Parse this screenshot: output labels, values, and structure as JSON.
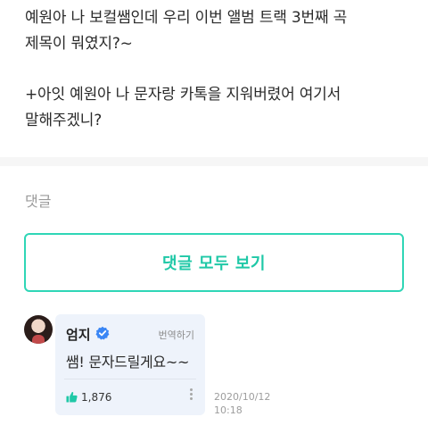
{
  "post": {
    "lines": [
      "예원아 나 보컬쌤인데 우리 이번 앨범 트랙 3번째 곡",
      "제목이 뭐였지?~",
      "+아잇 예원아 나 문자랑 카톡을 지워버렸어 여기서",
      "말해주겠니?"
    ]
  },
  "comments": {
    "section_label": "댓글",
    "view_all_label": "댓글 모두 보기"
  },
  "comment": {
    "author": "엄지",
    "translate_label": "번역하기",
    "text": "쌤! 문자드릴게요~~",
    "like_count": "1,876",
    "date": "2020/10/12",
    "time": "10:18"
  },
  "colors": {
    "accent": "#1fc8a7",
    "verified": "#3a86f5",
    "bubble": "#eef3fb"
  }
}
